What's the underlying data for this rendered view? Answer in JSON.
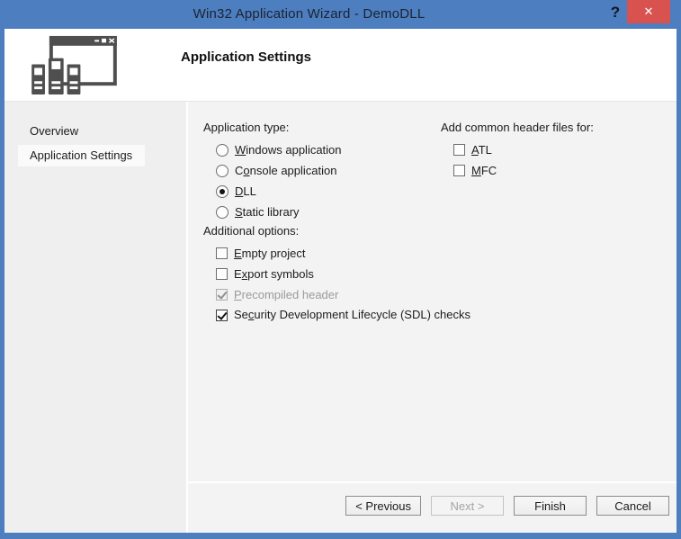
{
  "window": {
    "title": "Win32 Application Wizard - DemoDLL",
    "help_glyph": "?",
    "close_glyph": "✕",
    "accent_blue": "#4d7ec0",
    "close_red": "#d85350"
  },
  "header": {
    "title": "Application Settings",
    "icon": "wizard-window-with-libraries-icon"
  },
  "sidebar": {
    "items": [
      {
        "label": "Overview",
        "state": ""
      },
      {
        "label": "Application Settings",
        "state": "selected"
      }
    ]
  },
  "main": {
    "app_type": {
      "label": "Application type:",
      "options": [
        {
          "text": "Windows application",
          "u": 0,
          "state": "",
          "control": "radio"
        },
        {
          "text": "Console application",
          "u": 1,
          "state": "",
          "control": "radio"
        },
        {
          "text": "DLL",
          "u": 0,
          "state": "checked",
          "control": "radio"
        },
        {
          "text": "Static library",
          "u": 0,
          "state": "",
          "control": "radio"
        }
      ]
    },
    "additional_options": {
      "label": "Additional options:",
      "options": [
        {
          "text": "Empty project",
          "u": 0,
          "state": "",
          "control": "checkbox"
        },
        {
          "text": "Export symbols",
          "u": 1,
          "state": "",
          "control": "checkbox"
        },
        {
          "text": "Precompiled header",
          "u": 0,
          "state": "checked disabled",
          "control": "checkbox"
        },
        {
          "text": "Security Development Lifecycle (SDL) checks",
          "u": 2,
          "state": "checked",
          "control": "checkbox"
        }
      ]
    },
    "common_headers": {
      "label": "Add common header files for:",
      "options": [
        {
          "text": "ATL",
          "u": 0,
          "state": "",
          "control": "checkbox"
        },
        {
          "text": "MFC",
          "u": 0,
          "state": "",
          "control": "checkbox"
        }
      ]
    }
  },
  "footer": {
    "buttons": [
      {
        "text": "< Previous",
        "state": ""
      },
      {
        "text": "Next >",
        "state": "disabled"
      },
      {
        "text": "Finish",
        "state": ""
      },
      {
        "text": "Cancel",
        "state": ""
      }
    ]
  }
}
